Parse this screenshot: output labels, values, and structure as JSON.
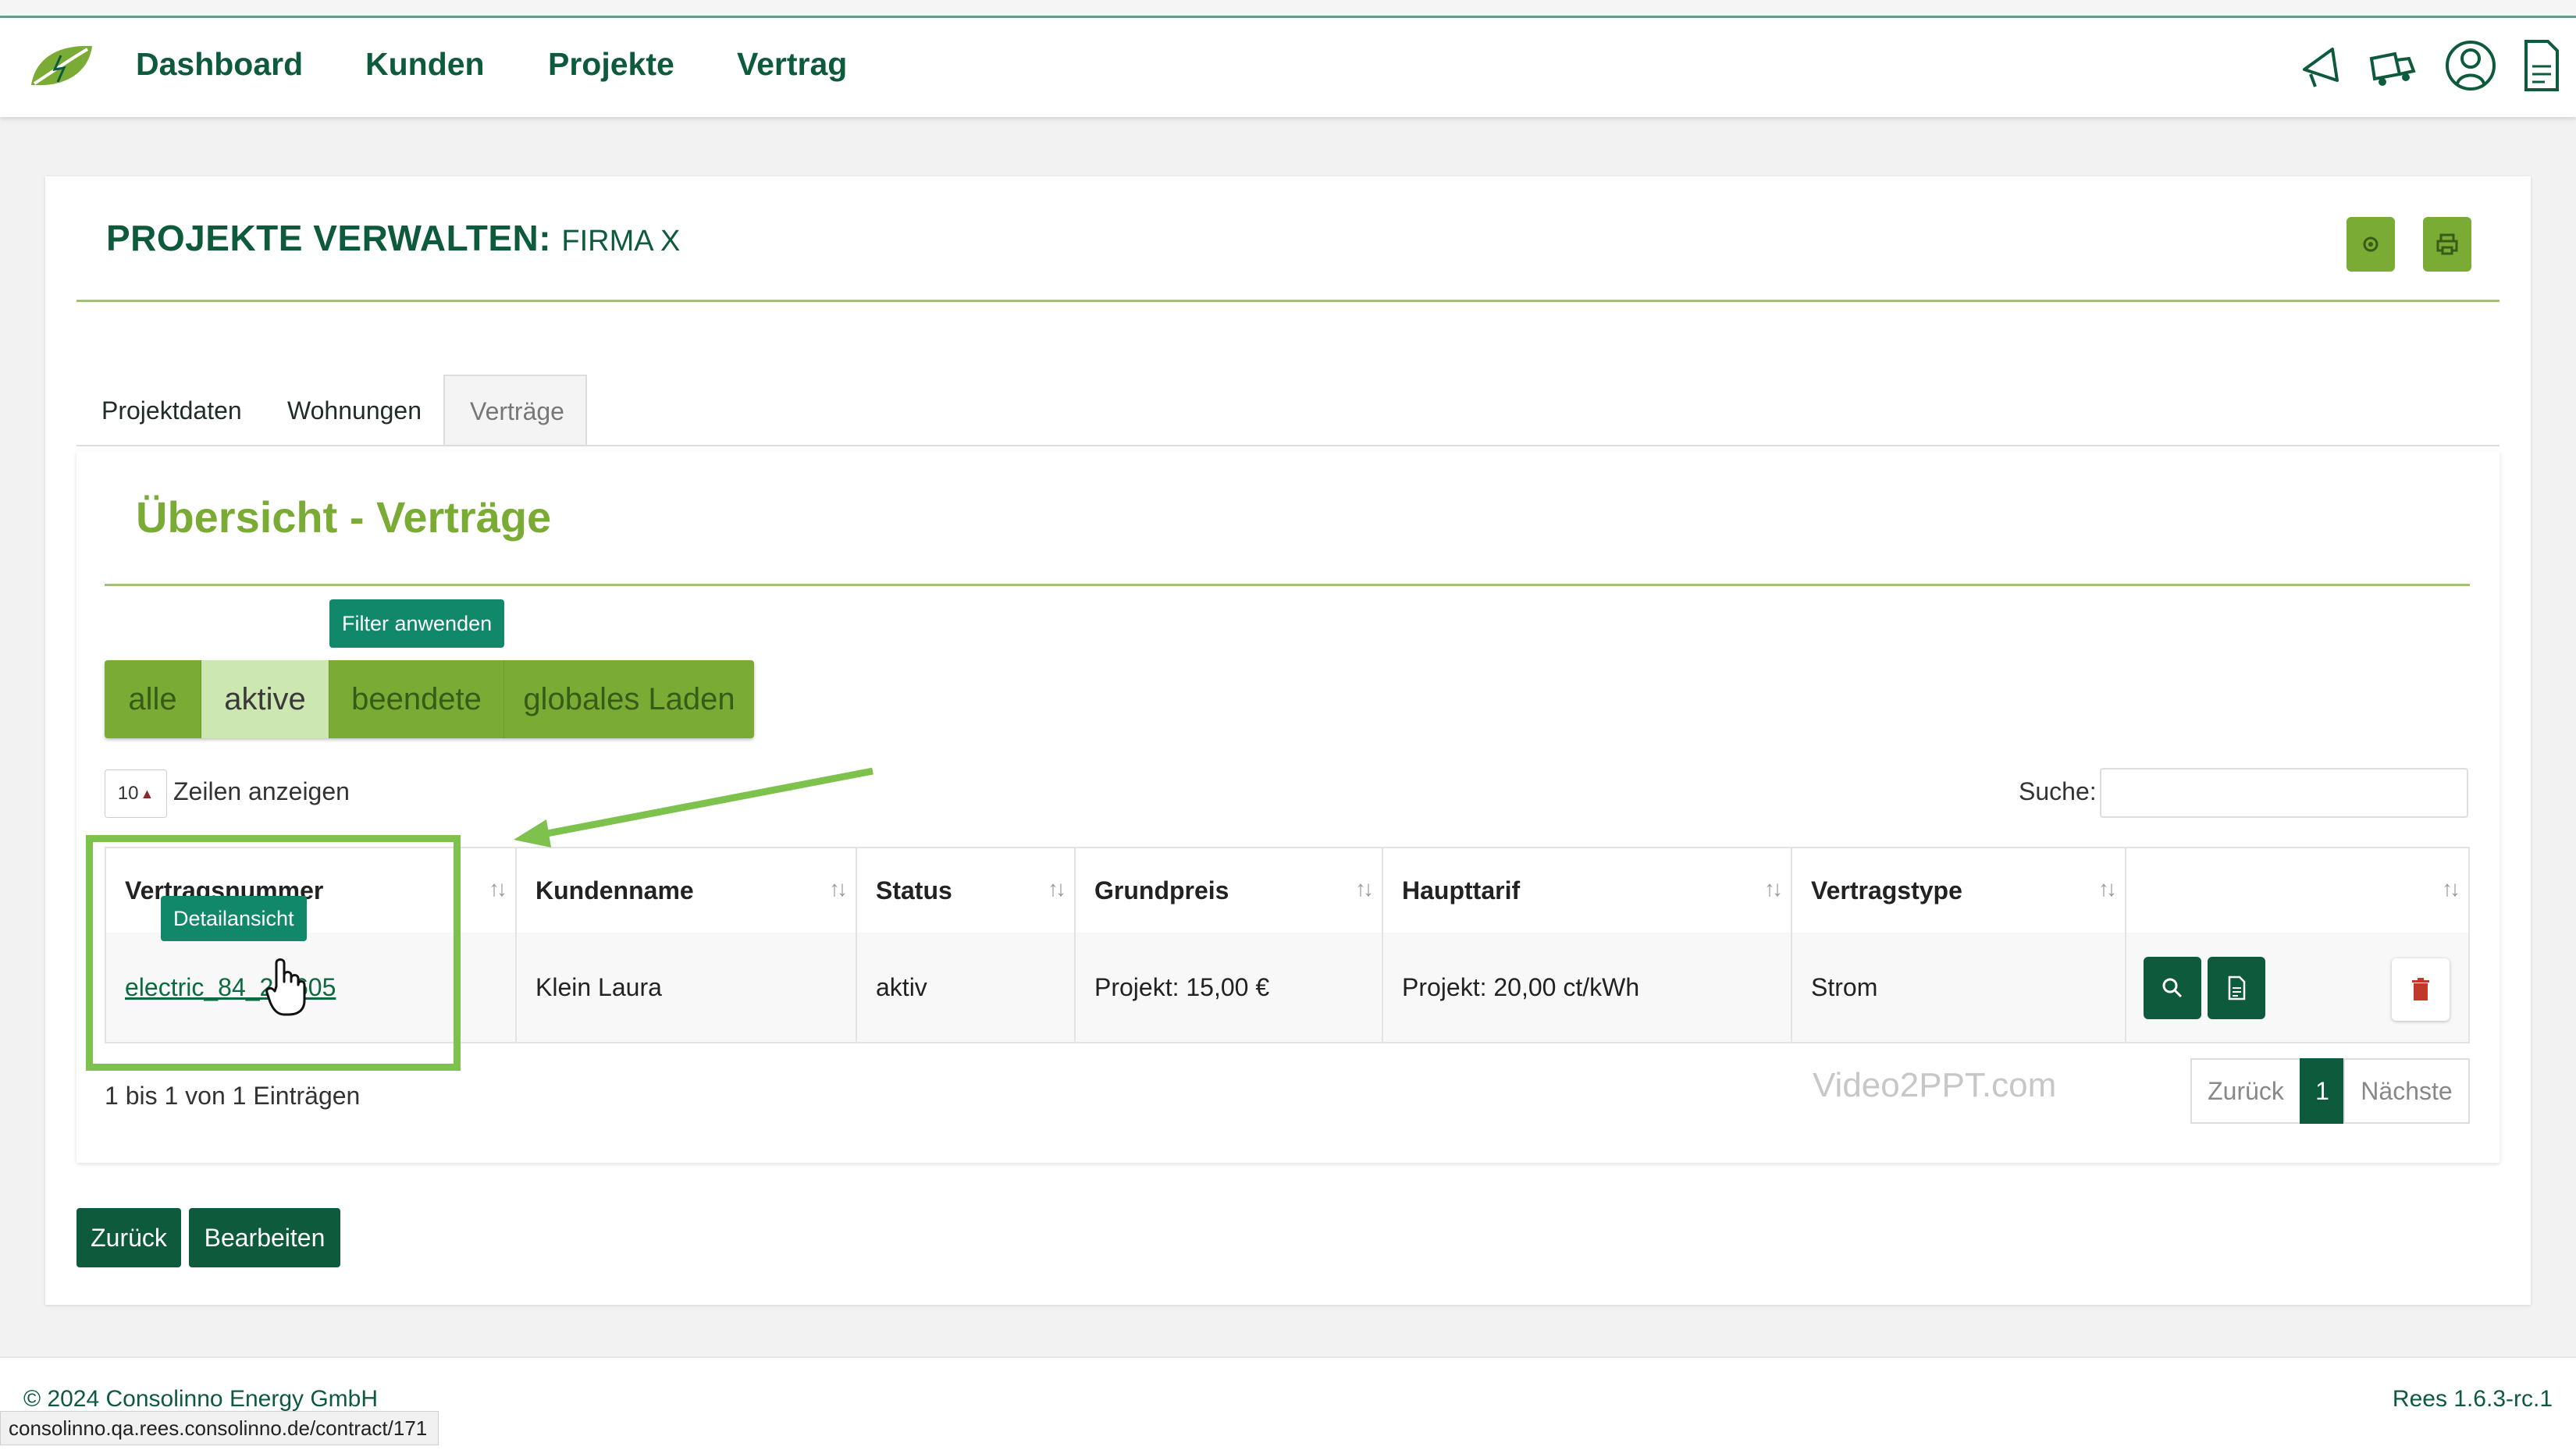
{
  "nav": {
    "links": [
      "Dashboard",
      "Kunden",
      "Projekte",
      "Vertrag"
    ],
    "icons": [
      "megaphone-icon",
      "truck-icon",
      "user-account-icon",
      "document-icon"
    ]
  },
  "page": {
    "title": "PROJEKTE VERWALTEN:",
    "subtitle": "FIRMA X",
    "header_buttons": [
      "settings-icon",
      "print-icon"
    ]
  },
  "tabs": [
    "Projektdaten",
    "Wohnungen",
    "Verträge"
  ],
  "active_tab": "Verträge",
  "section": {
    "title": "Übersicht - Verträge",
    "filter_tooltip": "Filter anwenden",
    "filters": [
      "alle",
      "aktive",
      "beendete",
      "globales Laden"
    ],
    "selected_filter": "aktive"
  },
  "table_controls": {
    "page_length": "10",
    "page_length_label": "Zeilen anzeigen",
    "search_label": "Suche:",
    "search_value": ""
  },
  "table": {
    "columns": [
      "Vertragsnummer",
      "Kundenname",
      "Status",
      "Grundpreis",
      "Haupttarif",
      "Vertragstype",
      ""
    ],
    "rows": [
      {
        "vertragsnummer": "electric_84_2m605",
        "kundenname": "Klein Laura",
        "status": "aktiv",
        "grundpreis": "Projekt: 15,00 €",
        "haupttarif": "Projekt: 20,00 ct/kWh",
        "vertragstype": "Strom",
        "actions": [
          "search-icon",
          "document-icon",
          "trash-icon"
        ]
      }
    ],
    "hover_tooltip": "Detailansicht"
  },
  "pagination": {
    "info": "1 bis 1 von 1 Einträgen",
    "prev": "Zurück",
    "current": "1",
    "next": "Nächste"
  },
  "watermark": "Video2PPT.com",
  "buttons": {
    "back": "Zurück",
    "edit": "Bearbeiten"
  },
  "footer": {
    "copyright": "© 2024 Consolinno Energy GmbH",
    "version": "Rees 1.6.3-rc.1"
  },
  "status_url": "consolinno.qa.rees.consolinno.de/contract/171",
  "colors": {
    "brand_dark": "#0e5a3c",
    "brand_light": "#7aab35",
    "annotation": "#7ec24e",
    "delete": "#c0392b"
  }
}
